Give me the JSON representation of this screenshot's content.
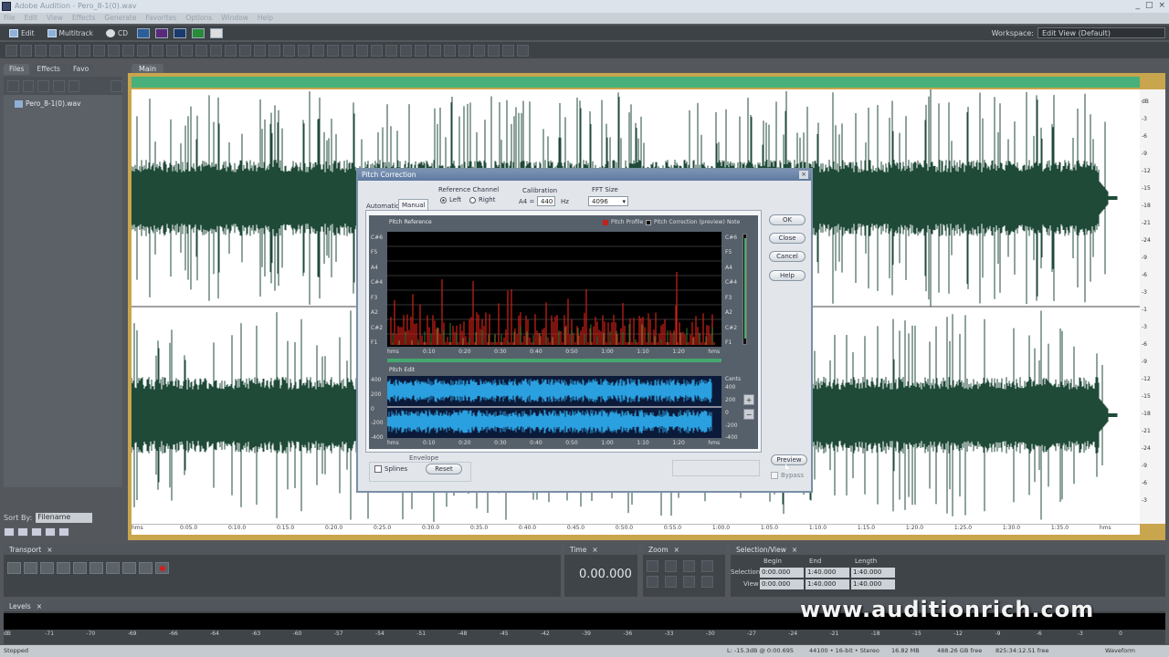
{
  "app": {
    "title": "Adobe Audition - Pero_8-1(0).wav",
    "window_buttons": [
      "_",
      "□",
      "×"
    ]
  },
  "menu": [
    "File",
    "Edit",
    "View",
    "Effects",
    "Generate",
    "Favorites",
    "Options",
    "Window",
    "Help"
  ],
  "views": {
    "edit": "Edit",
    "multitrack": "Multitrack",
    "cd": "CD"
  },
  "workspace": {
    "label": "Workspace:",
    "value": "Edit View (Default)"
  },
  "left_panel": {
    "tabs": [
      "Files",
      "Effects",
      "Favo"
    ],
    "file": "Pero_8-1(0).wav",
    "sort_label": "Sort By:",
    "sort_value": "Filename"
  },
  "main_tab": "Main",
  "ruler": [
    "hms",
    "0:05.0",
    "0:10.0",
    "0:15.0",
    "0:20.0",
    "0:25.0",
    "0:30.0",
    "0:35.0",
    "0:40.0",
    "0:45.0",
    "0:50.0",
    "0:55.0",
    "1:00.0",
    "1:05.0",
    "1:10.0",
    "1:15.0",
    "1:20.0",
    "1:25.0",
    "1:30.0",
    "1:35.0",
    "hms"
  ],
  "db_scale": [
    "dB",
    "-3",
    "-6",
    "-9",
    "-12",
    "-15",
    "-18",
    "-21",
    "-24",
    "-9",
    "-6",
    "-3",
    "-1",
    "-3",
    "-6",
    "-9",
    "-12",
    "-15",
    "-18",
    "-21",
    "-24",
    "-9",
    "-6",
    "-3"
  ],
  "dialog": {
    "title": "Pitch Correction",
    "close": "×",
    "tabs": {
      "automatic": "Automatic",
      "manual": "Manual"
    },
    "ref_channel": {
      "label": "Reference Channel",
      "left": "Left",
      "right": "Right"
    },
    "calibration": {
      "label": "Calibration",
      "prefix": "A4 =",
      "value": "440",
      "unit": "Hz"
    },
    "fft": {
      "label": "FFT Size",
      "value": "4096"
    },
    "buttons": {
      "ok": "OK",
      "close": "Close",
      "cancel": "Cancel",
      "help": "Help",
      "preview": "Preview",
      "reset": "Reset"
    },
    "bypass": "Bypass",
    "envelope": "Envelope",
    "splines": "Splines",
    "pitch_ref": {
      "title": "Pitch Reference",
      "legend_profile": "Pitch Profile",
      "legend_correction": "Pitch Correction (preview)",
      "unit_right": "Note",
      "notes_left": [
        "C#6",
        "F5",
        "A4",
        "C#4",
        "F3",
        "A2",
        "C#2",
        "F1"
      ],
      "notes_right": [
        "C#6",
        "F5",
        "A4",
        "C#4",
        "F3",
        "A2",
        "C#2",
        "F1"
      ],
      "times": [
        "hms",
        "0:10",
        "0:20",
        "0:30",
        "0:40",
        "0:50",
        "1:00",
        "1:10",
        "1:20",
        "hms"
      ]
    },
    "pitch_edit": {
      "title": "Pitch Edit",
      "unit_right": "Cents",
      "cents_left": [
        "400",
        "200",
        "0",
        "-200",
        "-400"
      ],
      "cents_right": [
        "400",
        "200",
        "0",
        "-200",
        "-400"
      ],
      "times": [
        "hms",
        "0:10",
        "0:20",
        "0:30",
        "0:40",
        "0:50",
        "1:00",
        "1:10",
        "1:20",
        "hms"
      ]
    }
  },
  "transport": {
    "title": "Transport",
    "close": "×"
  },
  "time_panel": {
    "title": "Time",
    "close": "×",
    "value": "0.00.000"
  },
  "zoom_panel": {
    "title": "Zoom",
    "close": "×"
  },
  "selection_panel": {
    "title": "Selection/View",
    "close": "×",
    "headers": [
      "Begin",
      "End",
      "Length"
    ],
    "rows": [
      {
        "label": "Selection",
        "begin": "0:00.000",
        "end": "1:40.000",
        "length": "1:40.000"
      },
      {
        "label": "View",
        "begin": "0:00.000",
        "end": "1:40.000",
        "length": "1:40.000"
      }
    ]
  },
  "levels": {
    "title": "Levels",
    "close": "×",
    "ticks": [
      "dB",
      "-71",
      "-70",
      "-69",
      "-66",
      "-64",
      "-63",
      "-60",
      "-57",
      "-54",
      "-51",
      "-48",
      "-45",
      "-42",
      "-39",
      "-36",
      "-33",
      "-30",
      "-27",
      "-24",
      "-21",
      "-18",
      "-15",
      "-12",
      "-9",
      "-6",
      "-3",
      "0"
    ]
  },
  "status": {
    "left": "Stopped",
    "items": [
      "L: -15.3dB @ 0:00.695",
      "44100 • 16-bit • Stereo",
      "16.82 MB",
      "488.26 GB free",
      "825:34:12.51 free",
      "Waveform"
    ]
  },
  "watermark": "www.auditionrich.com"
}
